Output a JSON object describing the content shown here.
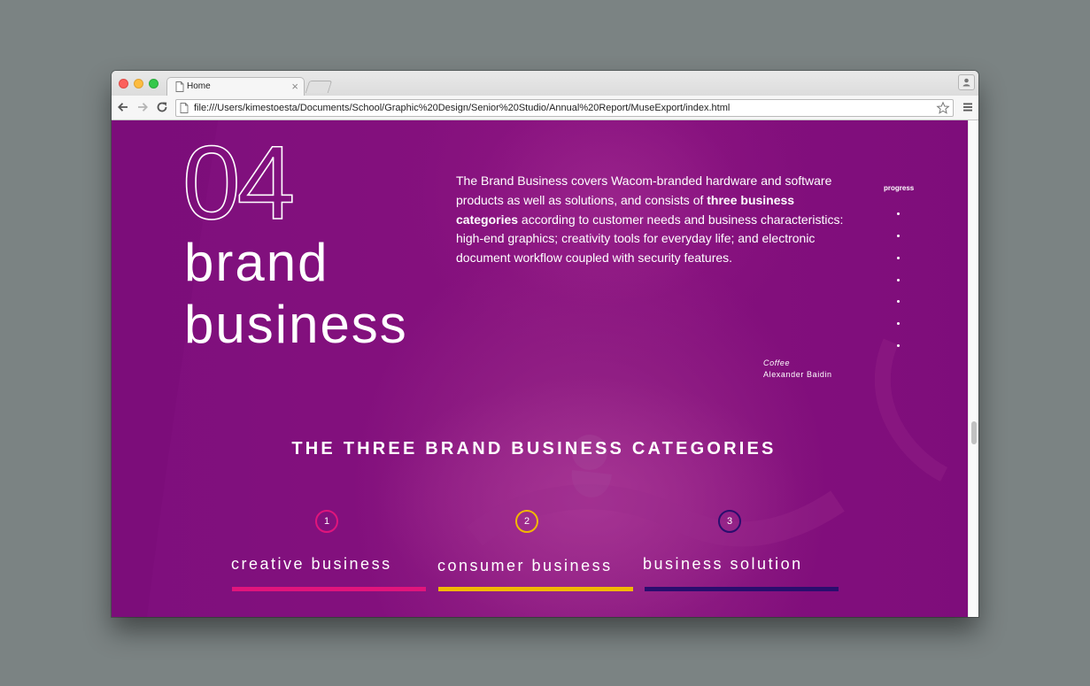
{
  "browser": {
    "tab_title": "Home",
    "tab_close": "×",
    "url": "file:///Users/kimestoesta/Documents/School/Graphic%20Design/Senior%20Studio/Annual%20Report/MuseExport/index.html",
    "icons": [
      "back-icon",
      "forward-icon",
      "reload-icon",
      "page-icon",
      "bookmark-star-icon",
      "menu-icon",
      "profile-icon"
    ]
  },
  "page": {
    "section_number": "04",
    "title_line1": "brand",
    "title_line2": "business",
    "intro_before": "The Brand Business covers Wacom-branded hardware and software products as well as solutions, and consists of ",
    "intro_bold": "three business categories",
    "intro_after": " according to customer needs and business characteristics: high-end graphics; creativity tools for everyday life; and electronic document workflow coupled with security features.",
    "progress_label": "progress",
    "progress_dot_count": 7,
    "credit_title": "Coffee",
    "credit_author": "Alexander Baidin",
    "categories_heading": "THE THREE BRAND BUSINESS CATEGORIES",
    "categories": [
      {
        "number": "1",
        "label": "creative business",
        "color": "#e0157c"
      },
      {
        "number": "2",
        "label": "consumer business",
        "color": "#f2b800"
      },
      {
        "number": "3",
        "label": "business solution",
        "color": "#2a0d6e"
      }
    ]
  },
  "colors": {
    "background_purple": "#82107d",
    "desktop": "#7b8383"
  }
}
